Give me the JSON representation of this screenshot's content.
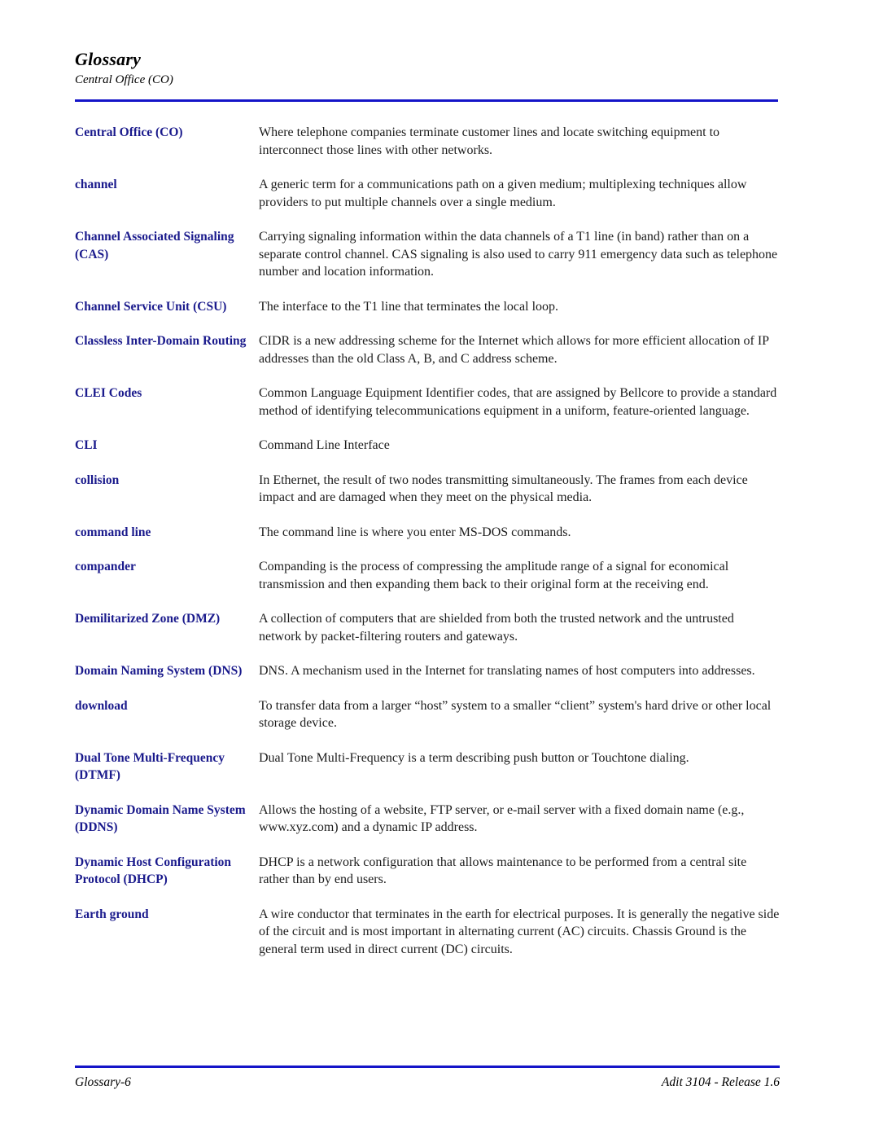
{
  "document": {
    "header": {
      "title": "Glossary",
      "subtitle": "Central Office (CO)"
    },
    "footer": {
      "page_label": "Glossary-6",
      "product_release": "Adit 3104 - Release 1.6"
    },
    "colors": {
      "term_blue": "#1a1a8c",
      "rule_blue": "#1414c8",
      "body_text": "#1c1c1c"
    },
    "entries": [
      {
        "term": "Central Office (CO)",
        "definition": "Where telephone companies terminate customer lines and locate switching equipment to interconnect those lines with other networks."
      },
      {
        "term": "channel",
        "definition": "A generic term for a communications path on a given medium; multiplexing techniques allow providers to put multiple channels over a single medium."
      },
      {
        "term": "Channel Associated Signaling (CAS)",
        "definition": "Carrying signaling information within the data channels of a T1 line (in band) rather than on a separate control channel. CAS signaling is also used to carry 911 emergency data such as telephone number and location information."
      },
      {
        "term": "Channel Service Unit (CSU)",
        "definition": "The interface to the T1 line that terminates the local loop."
      },
      {
        "term": "Classless Inter-Domain Routing",
        "definition": "CIDR is a new addressing scheme for the Internet which allows for more efficient allocation of IP addresses than the old Class A, B, and C address scheme."
      },
      {
        "term": "CLEI Codes",
        "definition": "Common Language Equipment Identifier codes, that are assigned by Bellcore to provide a standard method of identifying telecommunications equipment in a uniform, feature-oriented language."
      },
      {
        "term": "CLI",
        "definition": "Command Line Interface"
      },
      {
        "term": "collision",
        "definition": "In Ethernet, the result of two nodes transmitting simultaneously. The frames from each device impact and are damaged when they meet on the physical media."
      },
      {
        "term": "command line",
        "definition": "The command line is where you enter MS-DOS commands."
      },
      {
        "term": "compander",
        "definition": "Companding is the process of compressing the amplitude range of a signal for economical transmission and then expanding them back to their original form at the receiving end."
      },
      {
        "term": "Demilitarized Zone (DMZ)",
        "definition": "A collection of computers that are shielded from both the trusted network and the untrusted network by packet-filtering routers and gateways."
      },
      {
        "term": "Domain Naming System (DNS)",
        "definition": "DNS. A mechanism used in the Internet for translating names of host computers into addresses."
      },
      {
        "term": "download",
        "definition": "To transfer data from a larger “host” system to a smaller “client” system's hard drive or other local storage device."
      },
      {
        "term": "Dual Tone Multi-Frequency (DTMF)",
        "definition": "Dual Tone Multi-Frequency is a term describing push button or Touchtone dialing."
      },
      {
        "term": "Dynamic Domain Name System (DDNS)",
        "definition": "Allows the hosting of a website, FTP server, or e-mail server with a fixed domain name (e.g., www.xyz.com) and a dynamic IP address."
      },
      {
        "term": "Dynamic Host Configuration Protocol (DHCP)",
        "definition": "DHCP is a network configuration that allows maintenance to be performed from a central site rather than by end users."
      },
      {
        "term": "Earth ground",
        "definition": "A wire conductor that terminates in the earth for electrical purposes. It is generally the negative side of the circuit and is most important in alternating current (AC) circuits. Chassis Ground is the general term used in direct current (DC) circuits."
      }
    ]
  }
}
